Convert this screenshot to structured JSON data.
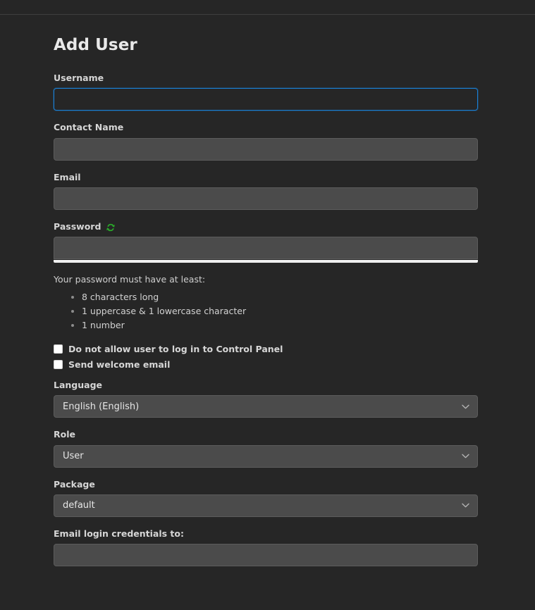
{
  "page": {
    "title": "Add User"
  },
  "fields": {
    "username": {
      "label": "Username",
      "value": "",
      "placeholder": ""
    },
    "contact_name": {
      "label": "Contact Name",
      "value": "",
      "placeholder": ""
    },
    "email": {
      "label": "Email",
      "value": "",
      "placeholder": ""
    },
    "password": {
      "label": "Password",
      "value": "",
      "placeholder": "",
      "generate_icon": "refresh-icon",
      "generate_icon_color": "#2aab2a",
      "strength_meter_color": "#f0f0f0"
    },
    "email_credentials": {
      "label": "Email login credentials to:",
      "value": "",
      "placeholder": ""
    }
  },
  "password_hint": {
    "intro": "Your password must have at least:",
    "requirements": [
      "8 characters long",
      "1 uppercase & 1 lowercase character",
      "1 number"
    ]
  },
  "checkboxes": [
    {
      "label": "Do not allow user to log in to Control Panel",
      "checked": false,
      "name": "disallow-login-checkbox"
    },
    {
      "label": "Send welcome email",
      "checked": false,
      "name": "send-welcome-email-checkbox"
    }
  ],
  "selects": {
    "language": {
      "label": "Language",
      "selected": "English (English)"
    },
    "role": {
      "label": "Role",
      "selected": "User"
    },
    "package": {
      "label": "Package",
      "selected": "default"
    }
  },
  "colors": {
    "page_background": "#262626",
    "input_background": "#4b4b4b",
    "focus_border": "#1a7fd4",
    "label_text": "#d6d6d6",
    "divider": "#3f3f3f"
  }
}
